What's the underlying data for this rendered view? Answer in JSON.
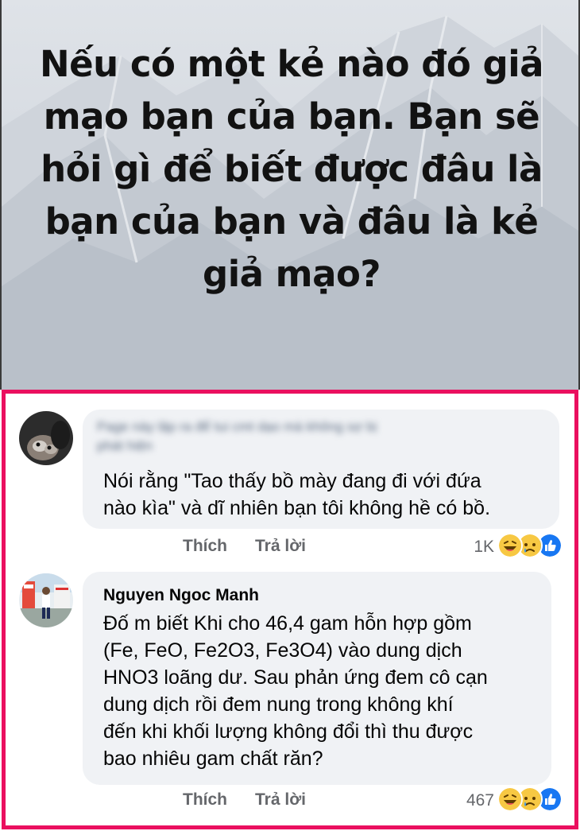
{
  "banner": {
    "title": "Nếu có một kẻ nào đó giả mạo bạn của bạn. Bạn sẽ hỏi gì để biết được đâu là bạn của bạn và đâu là kẻ giả mạo?"
  },
  "comments": [
    {
      "author_blurred": "Page này lập ra để tui cmt dạo mà không sợ bị\nphát hiện",
      "text": "Nói rằng \"Tao thấy bồ mày đang đi với đứa\nnào kìa\" và dĩ nhiên bạn tôi không hề có bồ.",
      "like_label": "Thích",
      "reply_label": "Trả lời",
      "reaction_count": "1K",
      "reactions": [
        "haha-icon",
        "sad-icon",
        "like-icon"
      ]
    },
    {
      "author": "Nguyen Ngoc Manh",
      "text": "Đố m biết Khi cho 46,4 gam hỗn hợp gồm\n(Fe, FeO, Fe2O3, Fe3O4) vào dung dịch\nHNO3 loãng dư. Sau phản ứng đem cô cạn\ndung dịch rồi đem nung trong không khí\nđến khi khối lượng không đổi thì thu được\nbao nhiêu gam chất răn?",
      "like_label": "Thích",
      "reply_label": "Trả lời",
      "reaction_count": "467",
      "reactions": [
        "haha-icon",
        "sad-icon",
        "like-icon"
      ]
    }
  ],
  "colors": {
    "frame": "#ea0f5f",
    "bubble": "#f0f2f5",
    "like_blue": "#1877f2",
    "emoji_yellow": "#f7c843"
  }
}
